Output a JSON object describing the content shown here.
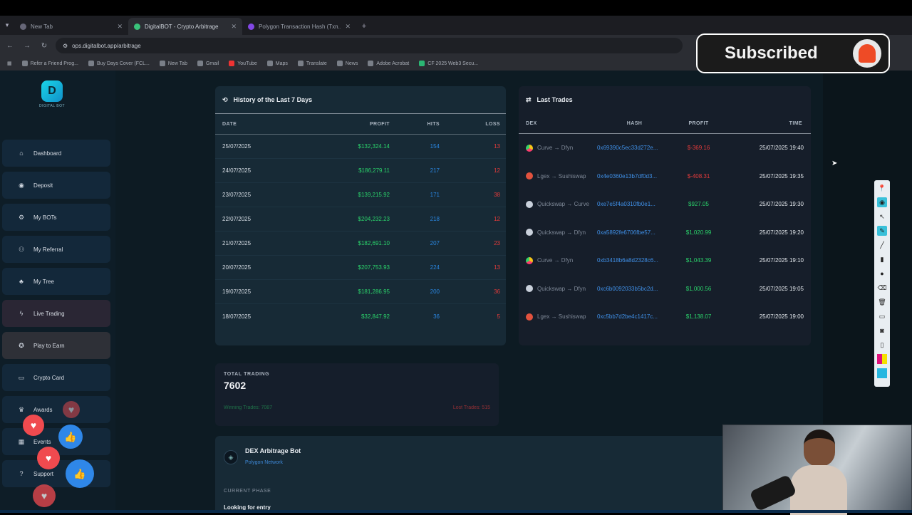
{
  "browser": {
    "tabs": [
      {
        "title": "New Tab",
        "active": false
      },
      {
        "title": "DigitalBOT - Crypto Arbitrage",
        "active": true
      },
      {
        "title": "Polygon Transaction Hash (Txn...",
        "active": false
      }
    ],
    "url": "ops.digitalbot.app/arbitrage",
    "bookmarks": [
      "Refer a Friend Prog...",
      "Buy Days Cover (FCL...",
      "New Tab",
      "Gmail",
      "YouTube",
      "Maps",
      "Translate",
      "News",
      "Adobe Acrobat",
      "CF 2025 Web3 Secu..."
    ]
  },
  "sidebar": {
    "logo_text": "DIGITAL BOT",
    "items": [
      {
        "label": "Dashboard",
        "icon": "home-icon"
      },
      {
        "label": "Deposit",
        "icon": "wallet-icon"
      },
      {
        "label": "My BOTs",
        "icon": "bot-icon"
      },
      {
        "label": "My Referral",
        "icon": "users-icon"
      },
      {
        "label": "My Tree",
        "icon": "tree-icon"
      },
      {
        "label": "Live Trading",
        "icon": "bolt-icon"
      },
      {
        "label": "Play to Earn",
        "icon": "gamepad-icon"
      },
      {
        "label": "Crypto Card",
        "icon": "card-icon"
      },
      {
        "label": "Awards",
        "icon": "trophy-icon"
      },
      {
        "label": "Events",
        "icon": "calendar-icon"
      },
      {
        "label": "Support",
        "icon": "support-icon"
      }
    ]
  },
  "history": {
    "title": "History of the Last 7 Days",
    "columns": [
      "DATE",
      "PROFIT",
      "HITS",
      "LOSS"
    ],
    "rows": [
      {
        "date": "25/07/2025",
        "profit": "$132,324.14",
        "hits": "154",
        "loss": "13"
      },
      {
        "date": "24/07/2025",
        "profit": "$186,279.11",
        "hits": "217",
        "loss": "12"
      },
      {
        "date": "23/07/2025",
        "profit": "$139,215.92",
        "hits": "171",
        "loss": "38"
      },
      {
        "date": "22/07/2025",
        "profit": "$204,232.23",
        "hits": "218",
        "loss": "12"
      },
      {
        "date": "21/07/2025",
        "profit": "$182,691.10",
        "hits": "207",
        "loss": "23"
      },
      {
        "date": "20/07/2025",
        "profit": "$207,753.93",
        "hits": "224",
        "loss": "13"
      },
      {
        "date": "19/07/2025",
        "profit": "$181,286.95",
        "hits": "200",
        "loss": "36"
      },
      {
        "date": "18/07/2025",
        "profit": "$32,847.92",
        "hits": "36",
        "loss": "5"
      }
    ]
  },
  "trades": {
    "title": "Last Trades",
    "columns": [
      "DEX",
      "HASH",
      "PROFIT",
      "TIME"
    ],
    "rows": [
      {
        "dex": "Curve → Dfyn",
        "coin": "multi",
        "hash": "0x69390c5ec33d272e...",
        "profit": "$-369.16",
        "type": "loss",
        "time": "25/07/2025 19:40"
      },
      {
        "dex": "Lgex → Sushiswap",
        "coin": "red",
        "hash": "0x4e0360e13b7df0d3...",
        "profit": "$-408.31",
        "type": "loss",
        "time": "25/07/2025 19:35"
      },
      {
        "dex": "Quickswap → Curve",
        "coin": "grey",
        "hash": "0xe7e5f4a0310fb0e1...",
        "profit": "$927.05",
        "type": "gain",
        "time": "25/07/2025 19:30"
      },
      {
        "dex": "Quickswap → Dfyn",
        "coin": "grey",
        "hash": "0xa5892fe6706fbe57...",
        "profit": "$1,020.99",
        "type": "gain",
        "time": "25/07/2025 19:20"
      },
      {
        "dex": "Curve → Dfyn",
        "coin": "multi",
        "hash": "0xb3418b6a8d2328c6...",
        "profit": "$1,043.39",
        "type": "gain",
        "time": "25/07/2025 19:10"
      },
      {
        "dex": "Quickswap → Dfyn",
        "coin": "grey",
        "hash": "0xc6b0092033b5bc2d...",
        "profit": "$1,000.56",
        "type": "gain",
        "time": "25/07/2025 19:05"
      },
      {
        "dex": "Lgex → Sushiswap",
        "coin": "red",
        "hash": "0xc5bb7d2be4c1417c...",
        "profit": "$1,138.07",
        "type": "gain",
        "time": "25/07/2025 19:00"
      }
    ]
  },
  "total_trading": {
    "label": "TOTAL TRADING",
    "value": "7602",
    "winning": "Winning Trades: 7087",
    "lost": "Lost Trades: 515"
  },
  "bot": {
    "title": "DEX Arbitrage Bot",
    "network": "Polygon Network",
    "phase_label": "CURRENT PHASE",
    "status": "Looking for entry"
  },
  "overlay": {
    "subscribed_label": "Subscribed"
  },
  "colors": {
    "profit": "#2bd36b",
    "hits": "#2a86e0",
    "loss": "#e53b3b"
  }
}
